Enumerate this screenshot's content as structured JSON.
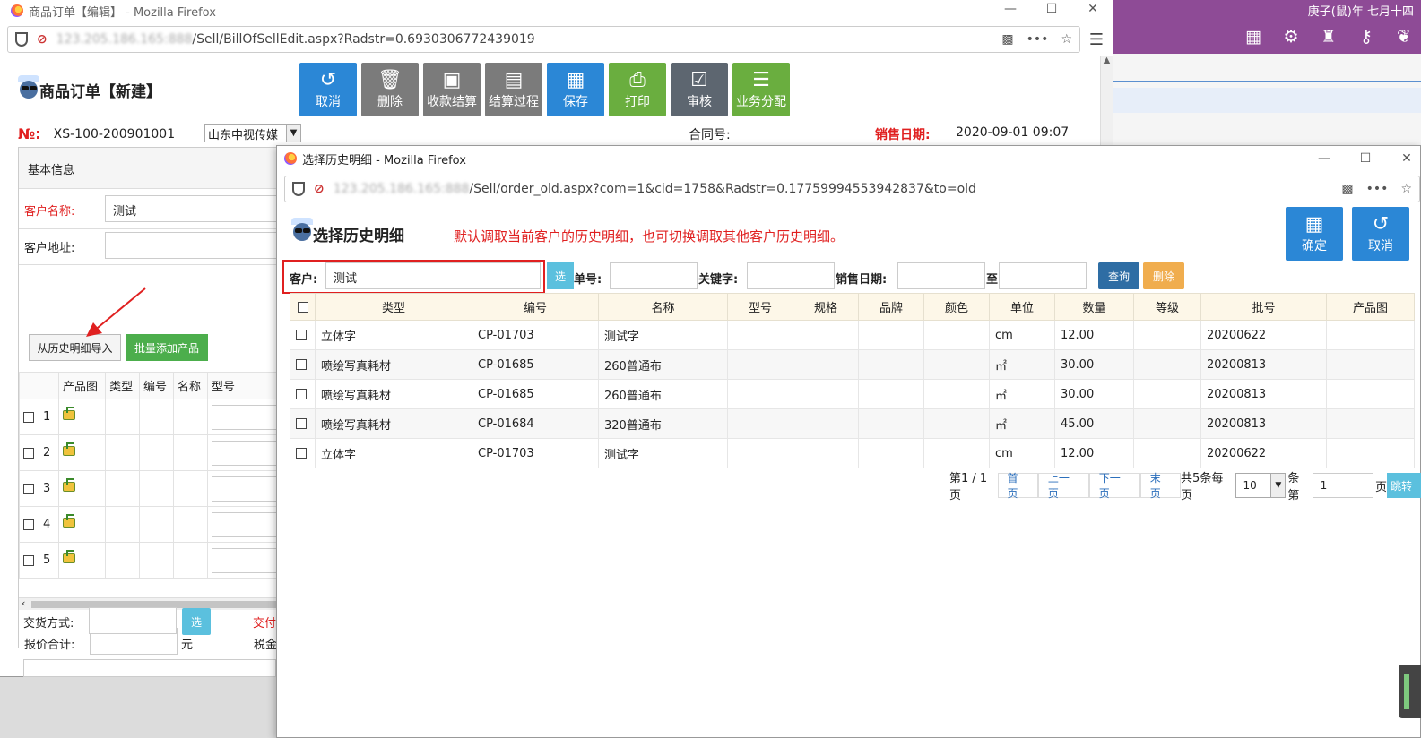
{
  "desktop": {
    "date": "庚子(鼠)年 七月十四",
    "icons": [
      "grid-plus-icon",
      "gear-icon",
      "shirt-icon",
      "key-icon",
      "leaf-icon"
    ]
  },
  "main_window": {
    "title": "商品订单【编辑】 - Mozilla Firefox",
    "url_blurred": "123.205.186.165:888",
    "url_path": "/Sell/BillOfSellEdit.aspx?Radstr=0.6930306772439019",
    "page_title": "商品订单【新建】",
    "toolbar": [
      {
        "label": "取消",
        "icon": "↺",
        "color": "blue"
      },
      {
        "label": "删除",
        "icon": "🗑",
        "color": "gray"
      },
      {
        "label": "收款结算",
        "icon": "▣",
        "color": "gray"
      },
      {
        "label": "结算过程",
        "icon": "▤",
        "color": "gray"
      },
      {
        "label": "保存",
        "icon": "▦",
        "color": "blue"
      },
      {
        "label": "打印",
        "icon": "⎙",
        "color": "green"
      },
      {
        "label": "审核",
        "icon": "☑",
        "color": "slate"
      },
      {
        "label": "业务分配",
        "icon": "☰",
        "color": "green"
      }
    ],
    "order_no_label": "№:",
    "order_no": "XS-100-200901001",
    "company_select": "山东中视传媒",
    "contract_label": "合同号:",
    "sale_date_label": "销售日期:",
    "sale_date": "2020-09-01 09:07",
    "basic_info": "基本信息",
    "customer_label": "客户名称:",
    "customer_value": "测试",
    "address_label": "客户地址:",
    "btn_import_history": "从历史明细导入",
    "btn_batch_add": "批量添加产品",
    "product_headers": [
      "产品图",
      "类型",
      "编号",
      "名称",
      "型号"
    ],
    "product_rows": [
      "1",
      "2",
      "3",
      "4",
      "5"
    ],
    "quote_total_label": "报价合计:",
    "yuan": "元",
    "tax_label": "税金",
    "delivery_label": "交货方式:",
    "select_btn": "选",
    "delivery_time_label": "交付"
  },
  "dialog": {
    "title": "选择历史明细 - Mozilla Firefox",
    "url_blurred": "123.205.186.165:888",
    "url_path": "/Sell/order_old.aspx?com=1&cid=1758&Radstr=0.17759994553942837&to=old",
    "page_title": "选择历史明细",
    "note": "默认调取当前客户的历史明细，也可切换调取其他客户历史明细。",
    "btn_confirm": "确定",
    "btn_cancel": "取消",
    "search": {
      "customer_label": "客户:",
      "customer_value": "测试",
      "select_btn": "选",
      "order_no_label": "单号:",
      "keyword_label": "关键字:",
      "sale_date_label": "销售日期:",
      "to_label": "至",
      "query_btn": "查询",
      "delete_btn": "删除"
    },
    "table": {
      "headers": [
        "类型",
        "编号",
        "名称",
        "型号",
        "规格",
        "品牌",
        "颜色",
        "单位",
        "数量",
        "等级",
        "批号",
        "产品图"
      ],
      "rows": [
        {
          "type": "立体字",
          "code": "CP-01703",
          "name": "测试字",
          "model": "",
          "spec": "",
          "brand": "",
          "color": "",
          "unit": "cm",
          "qty": "12.00",
          "grade": "",
          "batch": "20200622"
        },
        {
          "type": "喷绘写真耗材",
          "code": "CP-01685",
          "name": "260普通布",
          "model": "",
          "spec": "",
          "brand": "",
          "color": "",
          "unit": "㎡",
          "qty": "30.00",
          "grade": "",
          "batch": "20200813"
        },
        {
          "type": "喷绘写真耗材",
          "code": "CP-01685",
          "name": "260普通布",
          "model": "",
          "spec": "",
          "brand": "",
          "color": "",
          "unit": "㎡",
          "qty": "30.00",
          "grade": "",
          "batch": "20200813"
        },
        {
          "type": "喷绘写真耗材",
          "code": "CP-01684",
          "name": "320普通布",
          "model": "",
          "spec": "",
          "brand": "",
          "color": "",
          "unit": "㎡",
          "qty": "45.00",
          "grade": "",
          "batch": "20200813"
        },
        {
          "type": "立体字",
          "code": "CP-01703",
          "name": "测试字",
          "model": "",
          "spec": "",
          "brand": "",
          "color": "",
          "unit": "cm",
          "qty": "12.00",
          "grade": "",
          "batch": "20200622"
        }
      ]
    },
    "pager": {
      "info": "第1 / 1页",
      "first": "首页",
      "prev": "上一页",
      "next": "下一页",
      "last": "末页",
      "total": "共5条每页",
      "page_size": "10",
      "per_label": "条第",
      "page_input": "1",
      "page_label": "页",
      "jump": "跳转"
    }
  }
}
